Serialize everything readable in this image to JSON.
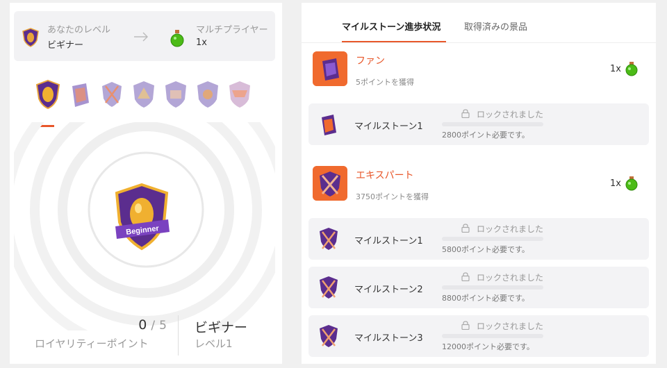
{
  "colors": {
    "accent": "#e8572a",
    "badge_purple": "#5b2d8e",
    "badge_gold": "#e8a43a",
    "potion_green": "#4cbb17"
  },
  "level_card": {
    "current_label": "あなたのレベル",
    "current_value": "ビギナー",
    "current_icon": "shield-egg-icon",
    "arrow_icon": "arrow-right-icon",
    "next_label": "マルチプライヤー",
    "next_value": "1x",
    "next_icon": "green-potion-icon"
  },
  "badges": [
    {
      "name": "beginner-badge-icon"
    },
    {
      "name": "fan-badge-icon"
    },
    {
      "name": "expert-badge-icon"
    },
    {
      "name": "level4-badge-icon"
    },
    {
      "name": "level5-badge-icon"
    },
    {
      "name": "level6-badge-icon"
    },
    {
      "name": "level7-badge-icon"
    }
  ],
  "center_badge": {
    "icon": "beginner-shield-icon",
    "ribbon_text": "Beginner"
  },
  "points": {
    "current": "0",
    "separator": "/",
    "total": "5",
    "label": "ロイヤリティーポイント"
  },
  "level": {
    "name": "ビギナー",
    "number": "レベル1"
  },
  "tabs": [
    {
      "label": "マイルストーン進歩状況",
      "active": true
    },
    {
      "label": "取得済みの景品",
      "active": false
    }
  ],
  "groups": [
    {
      "title": "ファン",
      "subtitle": "5ポイントを獲得",
      "reward": "1x",
      "icon": "fan-tier-icon",
      "milestones": [
        {
          "name": "マイルストーン1",
          "lock_text": "ロックされました",
          "requirement": "2800ポイント必要です。",
          "progress": 0
        }
      ]
    },
    {
      "title": "エキスパート",
      "subtitle": "3750ポイントを獲得",
      "reward": "1x",
      "icon": "expert-tier-icon",
      "milestones": [
        {
          "name": "マイルストーン1",
          "lock_text": "ロックされました",
          "requirement": "5800ポイント必要です。",
          "progress": 0
        },
        {
          "name": "マイルストーン2",
          "lock_text": "ロックされました",
          "requirement": "8800ポイント必要です。",
          "progress": 0
        },
        {
          "name": "マイルストーン3",
          "lock_text": "ロックされました",
          "requirement": "12000ポイント必要です。",
          "progress": 0
        }
      ]
    }
  ]
}
